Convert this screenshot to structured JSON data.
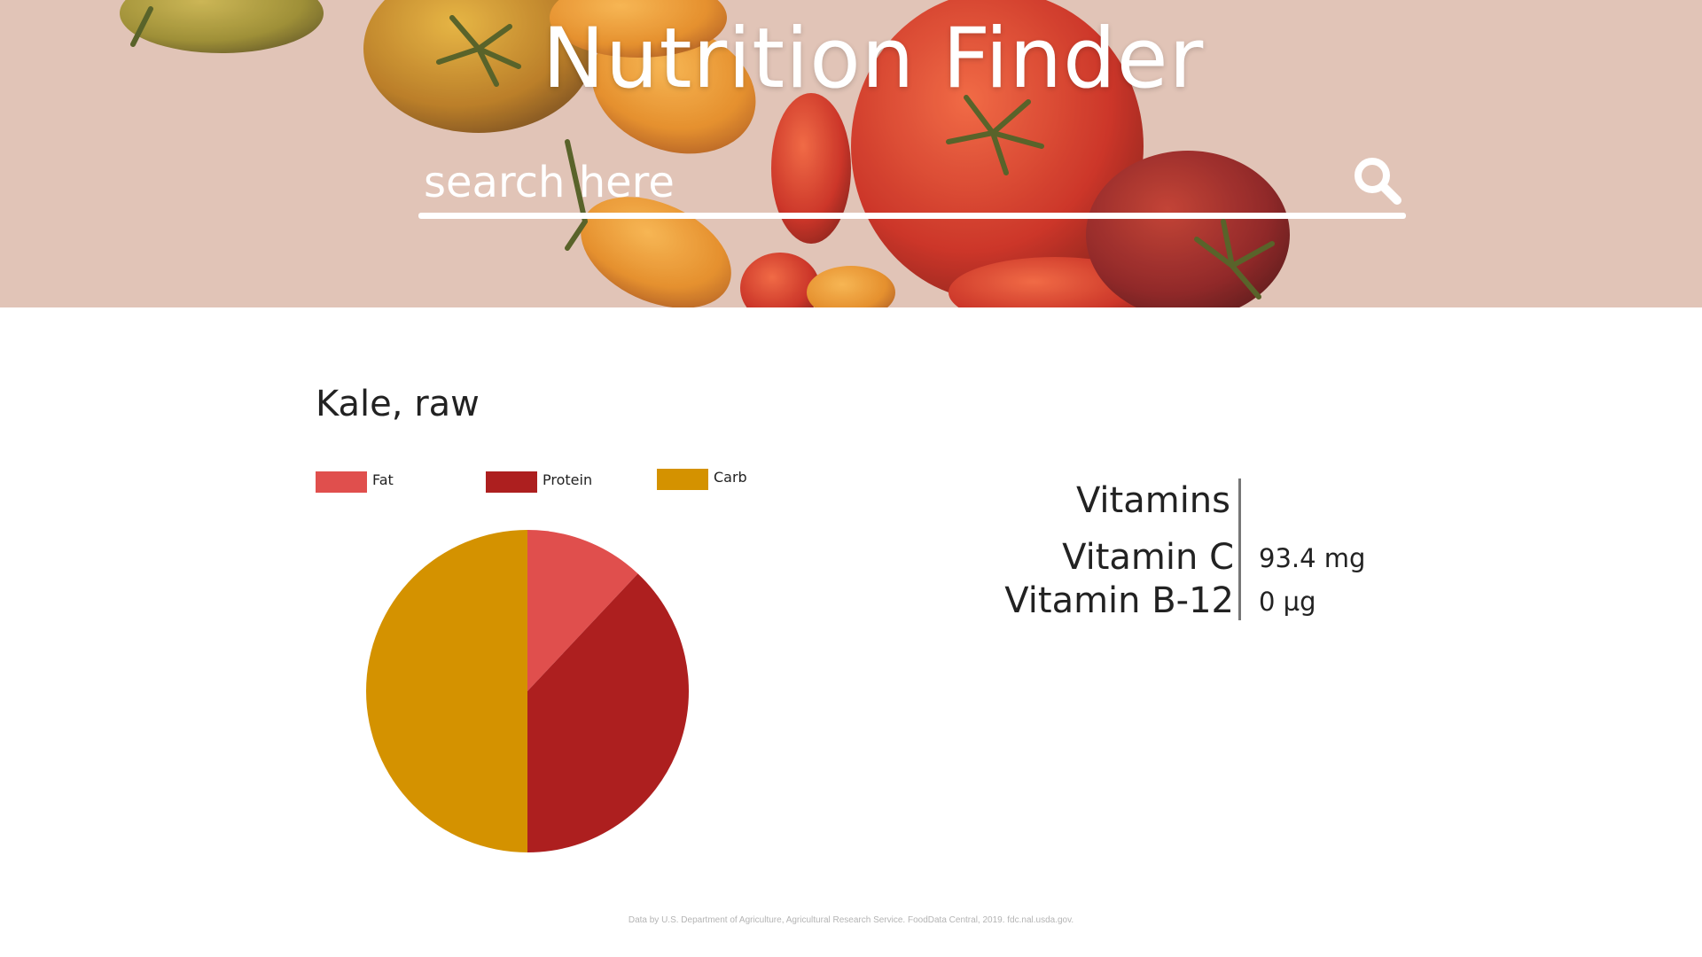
{
  "header": {
    "title": "Nutrition Finder",
    "search_placeholder": "search here",
    "search_icon": "search-icon"
  },
  "food": {
    "name": "Kale, raw"
  },
  "chart_data": {
    "type": "pie",
    "title": "",
    "legend_position": "top",
    "slices": [
      {
        "label": "Fat",
        "value": 12,
        "color": "#e04f4d"
      },
      {
        "label": "Protein",
        "value": 38,
        "color": "#ad1f1f"
      },
      {
        "label": "Carb",
        "value": 50,
        "color": "#d49200"
      }
    ]
  },
  "vitamins": {
    "heading": "Vitamins",
    "items": [
      {
        "name": "Vitamin C",
        "value": "93.4 mg"
      },
      {
        "name": "Vitamin B-12",
        "value": "0 µg"
      }
    ]
  },
  "footer": {
    "credit": "Data by U.S. Department of Agriculture, Agricultural Research Service. FoodData Central, 2019. fdc.nal.usda.gov."
  }
}
